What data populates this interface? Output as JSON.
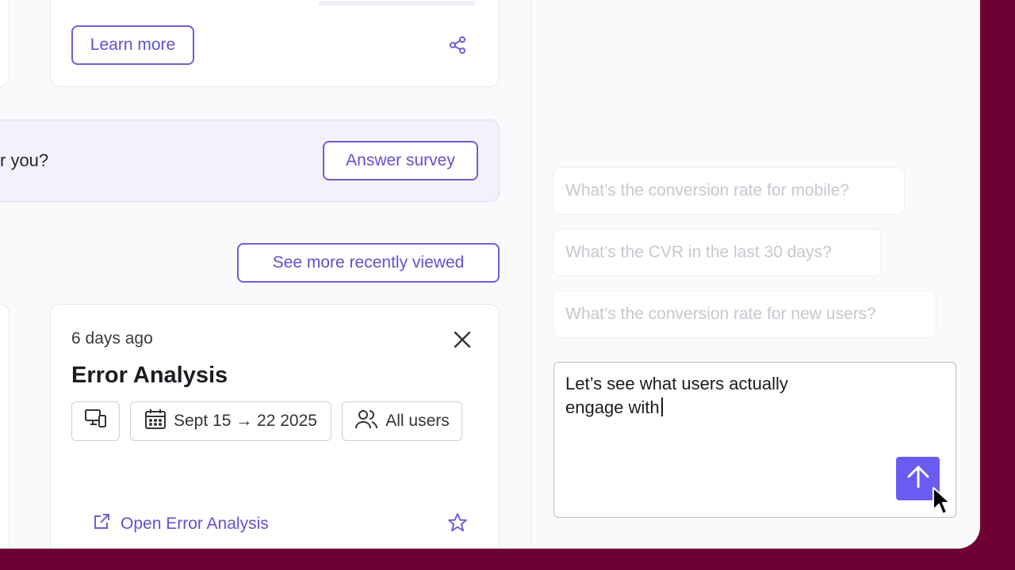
{
  "top_card": {
    "learn_more_label": "Learn more",
    "share_icon": "share-icon"
  },
  "survey": {
    "question_fragment": "r you?",
    "answer_label": "Answer survey"
  },
  "recently_viewed": {
    "see_more_label": "See more recently viewed"
  },
  "analysis_card": {
    "timestamp": "6 days ago",
    "title": "Error Analysis",
    "chips": {
      "device_icon": "devices-icon",
      "date_range": "Sept 15 → 22 2025",
      "audience": "All users"
    },
    "open_label": "Open Error Analysis",
    "close_icon": "close-icon",
    "star_icon": "star-icon"
  },
  "chat": {
    "suggestions": [
      "What’s the conversion rate for mobile?",
      "What’s the CVR in the last 30 days?",
      "What’s the conversion rate for new users?"
    ],
    "input_text": "Let’s see what users actually engage with",
    "send_icon": "arrow-up-icon"
  },
  "colors": {
    "accent": "#6d5fd8",
    "send_button": "#6a5cf0",
    "frame": "#6e0033"
  }
}
